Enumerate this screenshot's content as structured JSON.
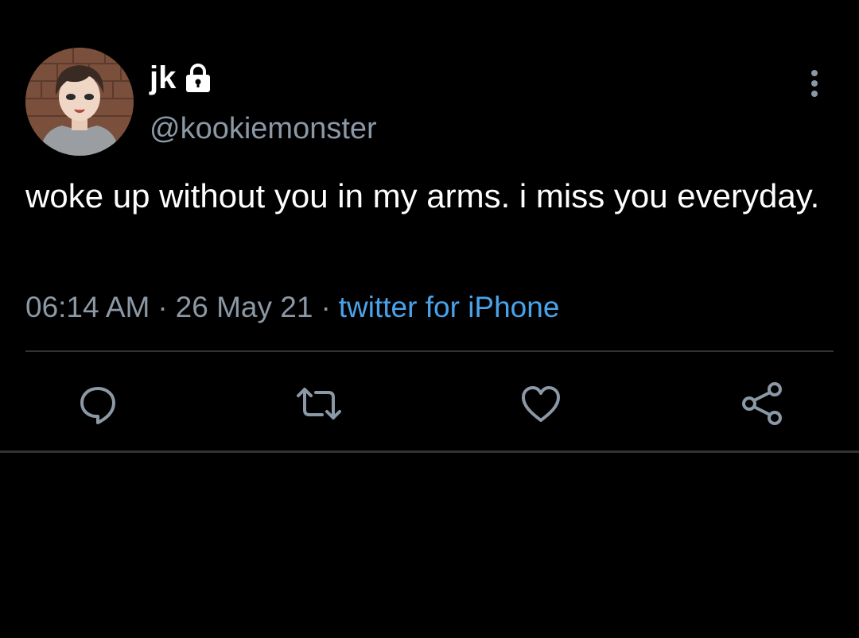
{
  "user": {
    "display_name": "jk",
    "handle": "@kookiemonster",
    "protected": true,
    "avatar_icon": "avatar-image"
  },
  "tweet": {
    "text": "woke up without you in my arms. i miss you everyday.",
    "time": "06:14 AM",
    "date": "26 May 21",
    "separator": "·",
    "source": "twitter for iPhone"
  },
  "actions": [
    {
      "name": "reply",
      "icon": "comment-icon"
    },
    {
      "name": "retweet",
      "icon": "retweet-icon"
    },
    {
      "name": "like",
      "icon": "heart-icon"
    },
    {
      "name": "share",
      "icon": "share-icon"
    }
  ],
  "colors": {
    "background": "#000000",
    "text_primary": "#ffffff",
    "text_secondary": "#8b98a5",
    "link": "#4aa3ea",
    "divider": "#2f3336"
  }
}
